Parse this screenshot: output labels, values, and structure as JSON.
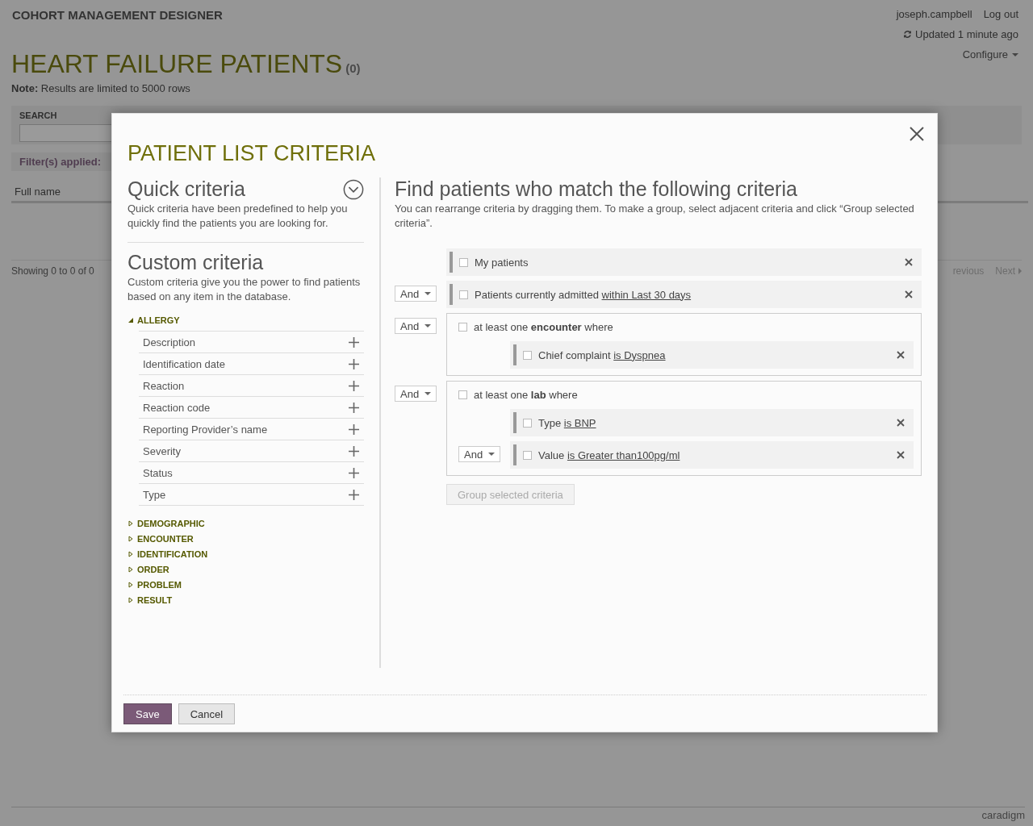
{
  "app": {
    "title": "COHORT MANAGEMENT DESIGNER",
    "user": "joseph.campbell",
    "logout": "Log out",
    "updated": "Updated 1 minute ago",
    "configure": "Configure"
  },
  "page": {
    "title": "HEART FAILURE PATIENTS",
    "count": "(0)",
    "note": "**Note:** Results are limited to 5000 rows",
    "search_label": "SEARCH",
    "filters_applied": "Filter(s) applied:",
    "column": "Full name",
    "showing": "Showing 0 to 0 of 0",
    "previous": "revious",
    "next": "Next",
    "brand": "caradigm"
  },
  "dialog": {
    "title": "PATIENT LIST CRITERIA",
    "quick": {
      "heading": "Quick criteria",
      "text": "Quick criteria have been predefined to help you quickly find the patients you are looking for.",
      "expanded": false
    },
    "custom": {
      "heading": "Custom criteria",
      "text": "Custom criteria give you the power to find patients based on any item in the database.",
      "categories": [
        {
          "label": "ALLERGY",
          "expanded": true,
          "children": [
            {
              "label": "Description"
            },
            {
              "label": "Identification date"
            },
            {
              "label": "Reaction"
            },
            {
              "label": "Reaction code"
            },
            {
              "label": "Reporting Provider’s name"
            },
            {
              "label": "Severity"
            },
            {
              "label": "Status"
            },
            {
              "label": "Type"
            }
          ]
        },
        {
          "label": "DEMOGRAPHIC",
          "expanded": false
        },
        {
          "label": "ENCOUNTER",
          "expanded": false
        },
        {
          "label": "IDENTIFICATION",
          "expanded": false
        },
        {
          "label": "ORDER",
          "expanded": false
        },
        {
          "label": "PROBLEM",
          "expanded": false
        },
        {
          "label": "RESULT",
          "expanded": false
        }
      ]
    },
    "criteria": {
      "heading": "Find patients who match the following criteria",
      "text": "You can rearrange criteria by dragging them. To make a group, select adjacent criteria and click “Group selected criteria”.",
      "items": [
        {
          "kind": "row",
          "checked": false,
          "field": "My patients"
        },
        {
          "kind": "row",
          "operator": "And",
          "checked": false,
          "field": "Patients currently admitted",
          "value": "within Last 30 days"
        },
        {
          "kind": "group",
          "operator": "And",
          "checked": false,
          "text": "at least one **encounter** where",
          "children": [
            {
              "kind": "row",
              "checked": false,
              "field": "Chief complaint",
              "value": "is Dyspnea"
            }
          ]
        },
        {
          "kind": "group",
          "operator": "And",
          "checked": false,
          "text": "at least one **lab** where",
          "children": [
            {
              "kind": "row",
              "checked": false,
              "field": "Type",
              "value": "is BNP"
            },
            {
              "kind": "row",
              "operator": "And",
              "checked": false,
              "field": "Value",
              "value": "is Greater than100pg/ml"
            }
          ]
        }
      ],
      "group_button": {
        "label": "Group selected criteria",
        "disabled": true
      }
    },
    "buttons": [
      {
        "label": "Save",
        "kind": "primary"
      },
      {
        "label": "Cancel",
        "kind": "secondary"
      }
    ]
  }
}
